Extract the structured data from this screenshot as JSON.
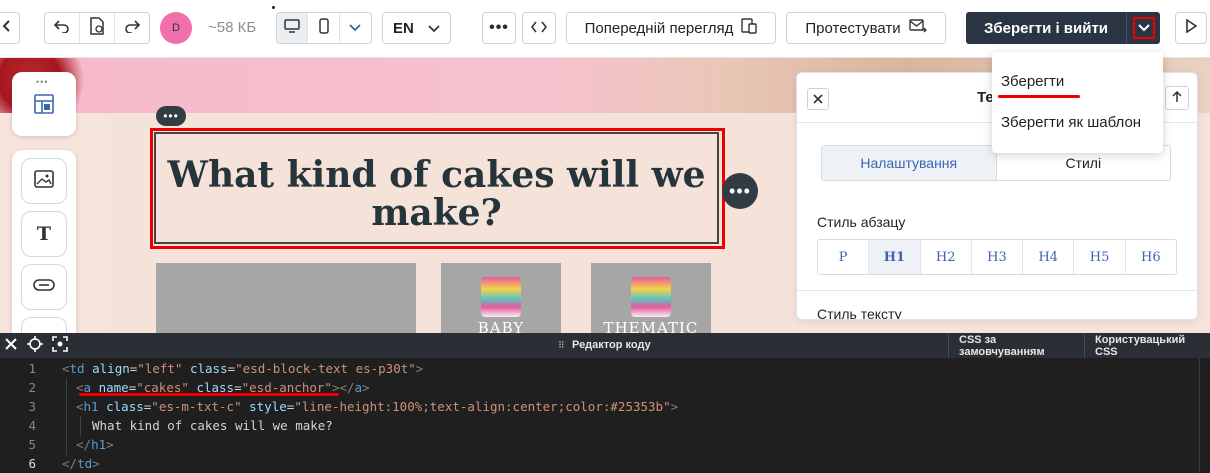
{
  "toolbar": {
    "size": "~58 КБ",
    "avatar_initial": "D",
    "language": "EN",
    "preview_label": "Попередній перегляд",
    "test_label": "Протестувати",
    "save_exit_label": "Зберегти і вийти"
  },
  "dropdown": {
    "save": "Зберегти",
    "save_as_template": "Зберегти як шаблон"
  },
  "canvas": {
    "heading": "What kind of cakes will we make?",
    "caption_baby": "Baby",
    "caption_thematic": "Thematic"
  },
  "settings": {
    "title": "Те",
    "tab_settings": "Налаштування",
    "tab_styles": "Стилі",
    "paragraph_style_label": "Стиль абзацу",
    "paragraph_options": [
      "P",
      "H1",
      "H2",
      "H3",
      "H4",
      "H5",
      "H6"
    ],
    "text_style_label": "Стиль тексту"
  },
  "code_editor": {
    "title": "Редактор коду",
    "tab_default_css": "CSS за замовчуванням",
    "tab_custom_css": "Користувацький CSS",
    "line_numbers": [
      "1",
      "2",
      "3",
      "4",
      "5",
      "6"
    ]
  },
  "colors": {
    "accent_dark": "#2b3443",
    "highlight_red": "#e00000",
    "heading_color": "#25353b",
    "avatar_pink": "#f06eaa"
  }
}
